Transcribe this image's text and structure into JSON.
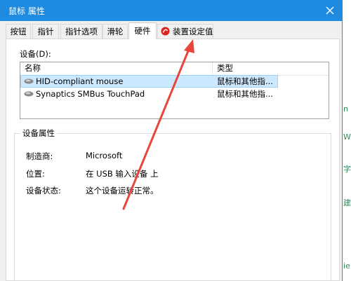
{
  "window": {
    "title": "鼠标 属性"
  },
  "tabs": [
    {
      "label": "按钮"
    },
    {
      "label": "指针"
    },
    {
      "label": "指针选项"
    },
    {
      "label": "滑轮"
    },
    {
      "label": "硬件"
    },
    {
      "label": "装置设定值"
    }
  ],
  "active_tab": "硬件",
  "devices": {
    "label": "设备(D):",
    "columns": [
      "名称",
      "类型"
    ],
    "rows": [
      {
        "name": "HID-compliant mouse",
        "type": "鼠标和其他指..."
      },
      {
        "name": "Synaptics SMBus TouchPad",
        "type": "鼠标和其他指..."
      }
    ]
  },
  "properties": {
    "title": "设备属性",
    "manufacturer_label": "制造商:",
    "manufacturer_value": "Microsoft",
    "location_label": "位置:",
    "location_value": "在 USB 输入设备 上",
    "status_label": "设备状态:",
    "status_value": "这个设备运转正常。"
  },
  "background_glyphs": [
    "n",
    "W",
    "字",
    "建",
    "ie"
  ],
  "colors": {
    "titlebar": "#1e8ae0",
    "selection": "#cce8ff",
    "arrow": "#e8463a",
    "synaptics_red": "#d9251d"
  },
  "icons": {
    "close": "close-icon",
    "synaptics": "synaptics-icon",
    "mouse": "mouse-device-icon"
  }
}
